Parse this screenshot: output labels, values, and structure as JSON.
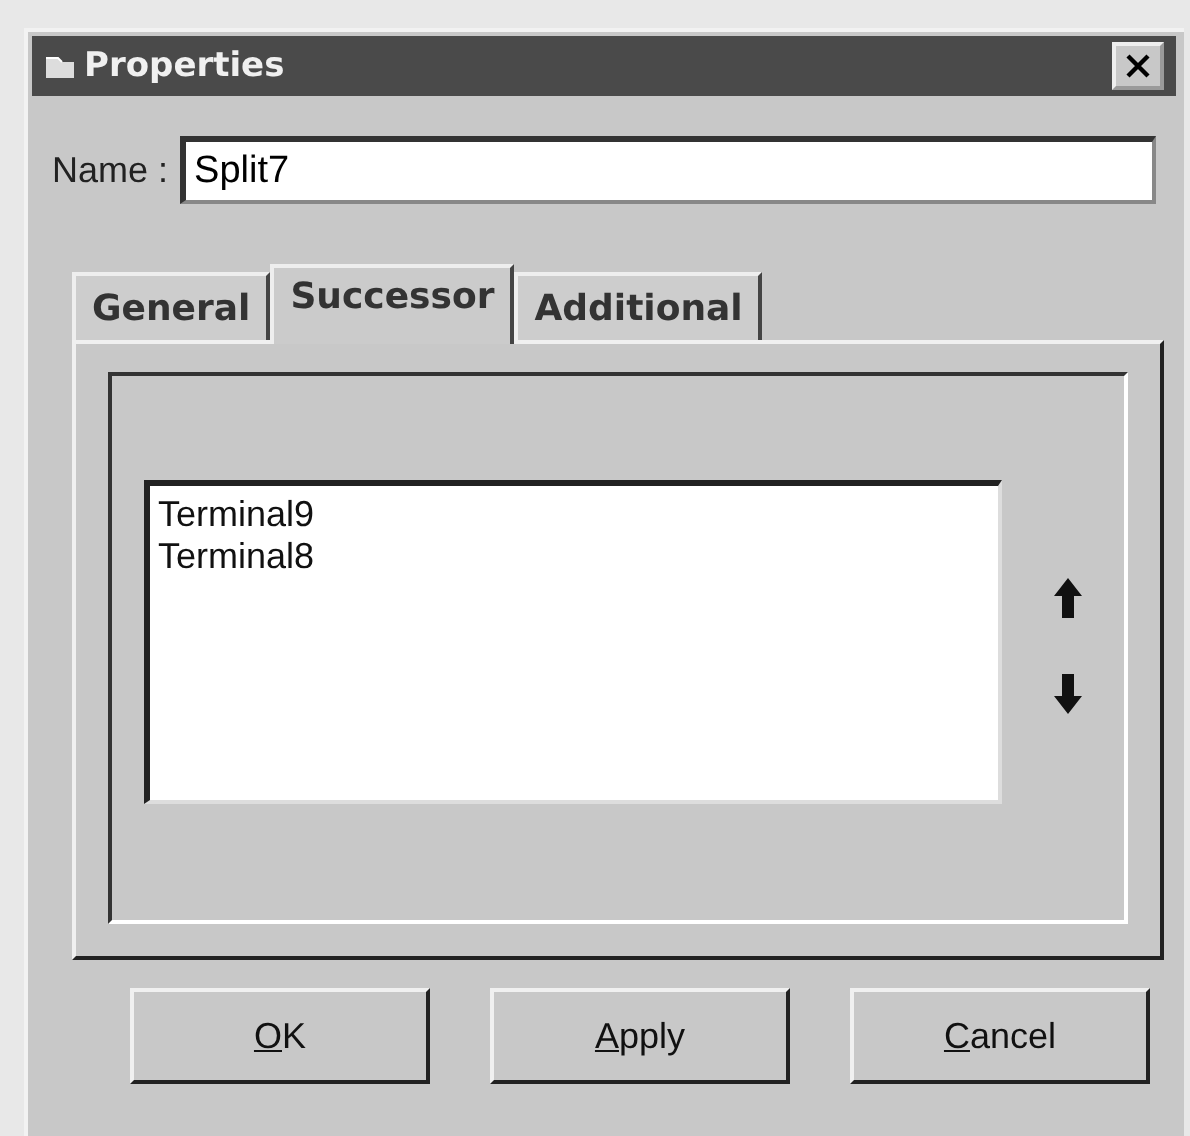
{
  "window": {
    "title": "Properties"
  },
  "name_field": {
    "label": "Name :",
    "value": "Split7"
  },
  "tabs": [
    {
      "label": "General",
      "selected": false
    },
    {
      "label": "Successor",
      "selected": true
    },
    {
      "label": "Additional",
      "selected": false
    }
  ],
  "successors": {
    "items": [
      "Terminal9",
      "Terminal8"
    ]
  },
  "buttons": [
    {
      "label": "OK",
      "underline_first": true
    },
    {
      "label": "Apply",
      "underline_first": true
    },
    {
      "label": "Cancel",
      "underline_first": true
    }
  ]
}
